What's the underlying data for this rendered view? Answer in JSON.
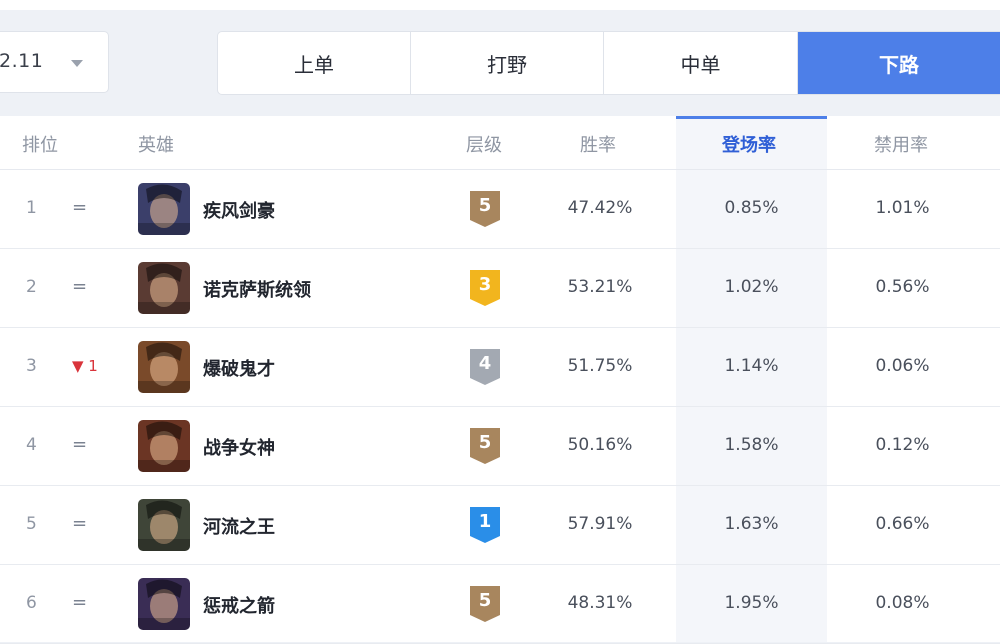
{
  "version": {
    "value": "2.11"
  },
  "tabs": [
    {
      "label": "上单",
      "active": false
    },
    {
      "label": "打野",
      "active": false
    },
    {
      "label": "中单",
      "active": false
    },
    {
      "label": "下路",
      "active": true
    }
  ],
  "table": {
    "headers": {
      "rank": "排位",
      "hero": "英雄",
      "tier": "层级",
      "win_rate": "胜率",
      "pick_rate": "登场率",
      "ban_rate": "禁用率"
    },
    "rows": [
      {
        "rank": "1",
        "trend": "=",
        "trend_dir": "same",
        "hero": "疾风剑豪",
        "tier": "5",
        "tier_color": "#a8865e",
        "win_rate": "47.42%",
        "pick_rate": "0.85%",
        "ban_rate": "1.01%",
        "avatar_color": "#3b3f6a"
      },
      {
        "rank": "2",
        "trend": "=",
        "trend_dir": "same",
        "hero": "诺克萨斯统领",
        "tier": "3",
        "tier_color": "#f2b51e",
        "win_rate": "53.21%",
        "pick_rate": "1.02%",
        "ban_rate": "0.56%",
        "avatar_color": "#5a3b33"
      },
      {
        "rank": "3",
        "trend": "▼ 1",
        "trend_dir": "down",
        "hero": "爆破鬼才",
        "tier": "4",
        "tier_color": "#a3a9b2",
        "win_rate": "51.75%",
        "pick_rate": "1.14%",
        "ban_rate": "0.06%",
        "avatar_color": "#7a4a2a"
      },
      {
        "rank": "4",
        "trend": "=",
        "trend_dir": "same",
        "hero": "战争女神",
        "tier": "5",
        "tier_color": "#a8865e",
        "win_rate": "50.16%",
        "pick_rate": "1.58%",
        "ban_rate": "0.12%",
        "avatar_color": "#6b3524"
      },
      {
        "rank": "5",
        "trend": "=",
        "trend_dir": "same",
        "hero": "河流之王",
        "tier": "1",
        "tier_color": "#2a8ee8",
        "win_rate": "57.91%",
        "pick_rate": "1.63%",
        "ban_rate": "0.66%",
        "avatar_color": "#3f4538"
      },
      {
        "rank": "6",
        "trend": "=",
        "trend_dir": "same",
        "hero": "惩戒之箭",
        "tier": "5",
        "tier_color": "#a8865e",
        "win_rate": "48.31%",
        "pick_rate": "1.95%",
        "ban_rate": "0.08%",
        "avatar_color": "#3a2d55"
      }
    ]
  }
}
